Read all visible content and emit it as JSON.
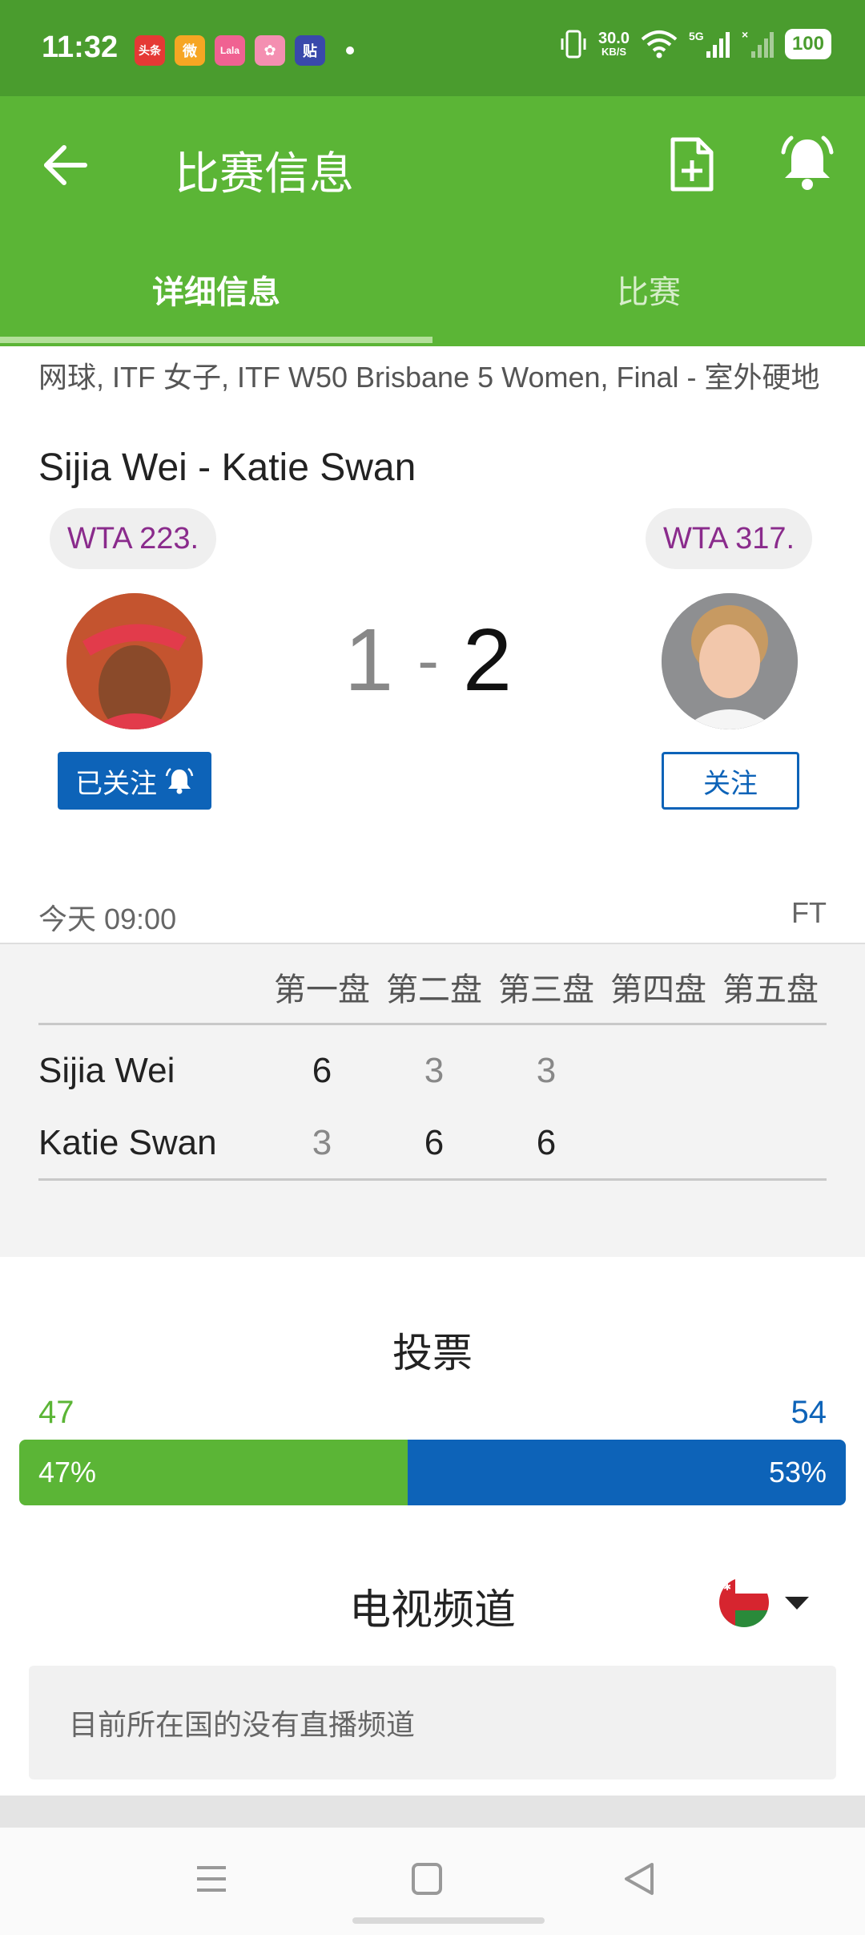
{
  "status_bar": {
    "time": "11:32",
    "net_speed": "30.0",
    "net_unit": "KB/S",
    "network": "5G",
    "battery": "100",
    "apps": [
      {
        "name": "toutiao",
        "label": "头条",
        "color": "#e53935"
      },
      {
        "name": "weibo",
        "label": "微",
        "color": "#f6a623"
      },
      {
        "name": "app-pink",
        "label": "Lala",
        "color": "#f06292"
      },
      {
        "name": "app-flower",
        "label": "✿",
        "color": "#f48fb1"
      },
      {
        "name": "tieba",
        "label": "贴",
        "color": "#3949ab"
      }
    ]
  },
  "appbar": {
    "title": "比赛信息"
  },
  "tabs": [
    {
      "label": "详细信息",
      "active": true
    },
    {
      "label": "比赛",
      "active": false
    }
  ],
  "match": {
    "meta": "网球, ITF 女子, ITF W50 Brisbane 5 Women, Final - 室外硬地",
    "title": "Sijia Wei - Katie Swan",
    "left_rank": "WTA 223.",
    "right_rank": "WTA 317.",
    "score_left": "1",
    "score_sep": "-",
    "score_right": "2",
    "follow_left": "已关注",
    "follow_right": "关注",
    "time": "今天 09:00",
    "status": "FT"
  },
  "sets": {
    "headers": [
      "第一盘",
      "第二盘",
      "第三盘",
      "第四盘",
      "第五盘"
    ],
    "rows": [
      {
        "player": "Sijia Wei",
        "scores": [
          "6",
          "3",
          "3"
        ]
      },
      {
        "player": "Katie Swan",
        "scores": [
          "3",
          "6",
          "6"
        ]
      }
    ]
  },
  "votes": {
    "title": "投票",
    "left_count": "47",
    "right_count": "54",
    "left_pct": "47%",
    "right_pct": "53%",
    "left_fraction": 0.47,
    "left_color": "#5bb536",
    "right_color": "#0d63b8"
  },
  "tv": {
    "title": "电视频道",
    "empty_message": "目前所在国的没有直播频道",
    "flag_icon": "oman-flag-icon"
  }
}
